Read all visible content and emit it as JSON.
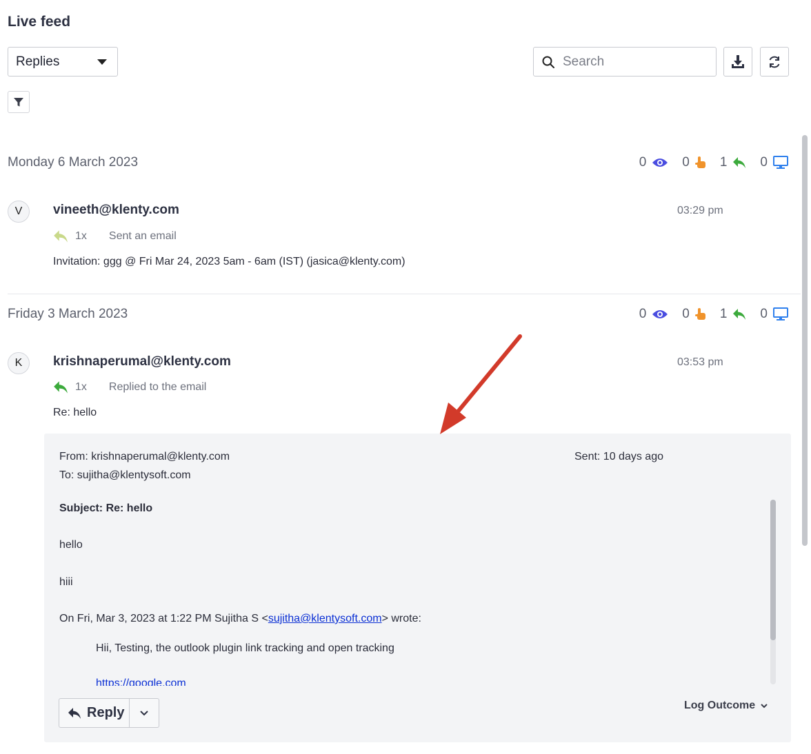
{
  "header": {
    "title": "Live feed",
    "view_select": "Replies",
    "search_placeholder": "Search"
  },
  "colors": {
    "views": "#4a4de0",
    "clicks": "#f0932b",
    "replies": "#3caa3c",
    "visits": "#2f80ed",
    "sent_icon": "#c9d98a",
    "link": "#0a2fd4"
  },
  "groups": [
    {
      "date": "Monday 6 March 2023",
      "stats": {
        "views": "0",
        "clicks": "0",
        "replies": "1",
        "visits": "0"
      },
      "item": {
        "initial": "V",
        "email": "vineeth@klenty.com",
        "time": "03:29 pm",
        "count": "1x",
        "action": "Sent an email",
        "subject": "Invitation: ggg @ Fri Mar 24, 2023 5am - 6am (IST) (jasica@klenty.com)"
      }
    },
    {
      "date": "Friday 3 March 2023",
      "stats": {
        "views": "0",
        "clicks": "0",
        "replies": "1",
        "visits": "0"
      },
      "item": {
        "initial": "K",
        "email": "krishnaperumal@klenty.com",
        "time": "03:53 pm",
        "count": "1x",
        "action": "Replied to the email",
        "subject": "Re: hello"
      }
    }
  ],
  "email_preview": {
    "from": "From: krishnaperumal@klenty.com",
    "to": "To: sujitha@klentysoft.com",
    "sent": "Sent: 10 days ago",
    "subject": "Subject: Re: hello",
    "line1": "hello",
    "line2": "hiii",
    "quote_prefix": "On Fri, Mar 3, 2023 at 1:22 PM Sujitha S <",
    "quote_email": "sujitha@klentysoft.com",
    "quote_suffix": "> wrote:",
    "quoted_text": "Hii, Testing, the outlook plugin link tracking and open tracking",
    "quoted_link": "https://google.com",
    "reply_label": "Reply",
    "log_outcome_label": "Log Outcome"
  }
}
